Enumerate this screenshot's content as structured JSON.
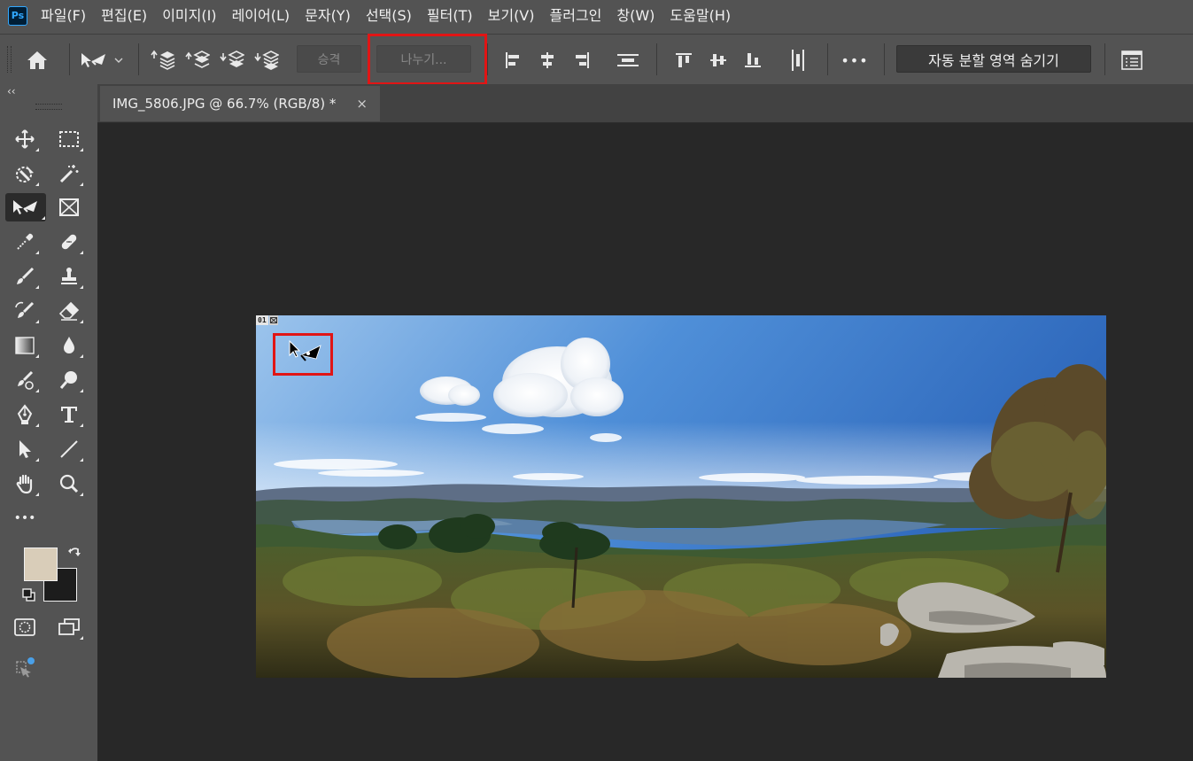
{
  "app": {
    "logo_text": "Ps"
  },
  "menu": [
    "파일(F)",
    "편집(E)",
    "이미지(I)",
    "레이어(L)",
    "문자(Y)",
    "선택(S)",
    "필터(T)",
    "보기(V)",
    "플러그인",
    "창(W)",
    "도움말(H)"
  ],
  "options_bar": {
    "promote_label": "승격",
    "divide_label": "나누기...",
    "hide_auto_slices_label": "자동 분할 영역 숨기기",
    "more_label": "•••"
  },
  "toolbar": {
    "collapse_label": "‹‹",
    "more_label": "•••"
  },
  "colors": {
    "foreground": "#d9cdb9",
    "background": "#1c1c1c",
    "highlight": "#e11515"
  },
  "document": {
    "tab_title": "IMG_5806.JPG @ 66.7% (RGB/8) *",
    "close_label": "×",
    "slice_number": "01"
  }
}
